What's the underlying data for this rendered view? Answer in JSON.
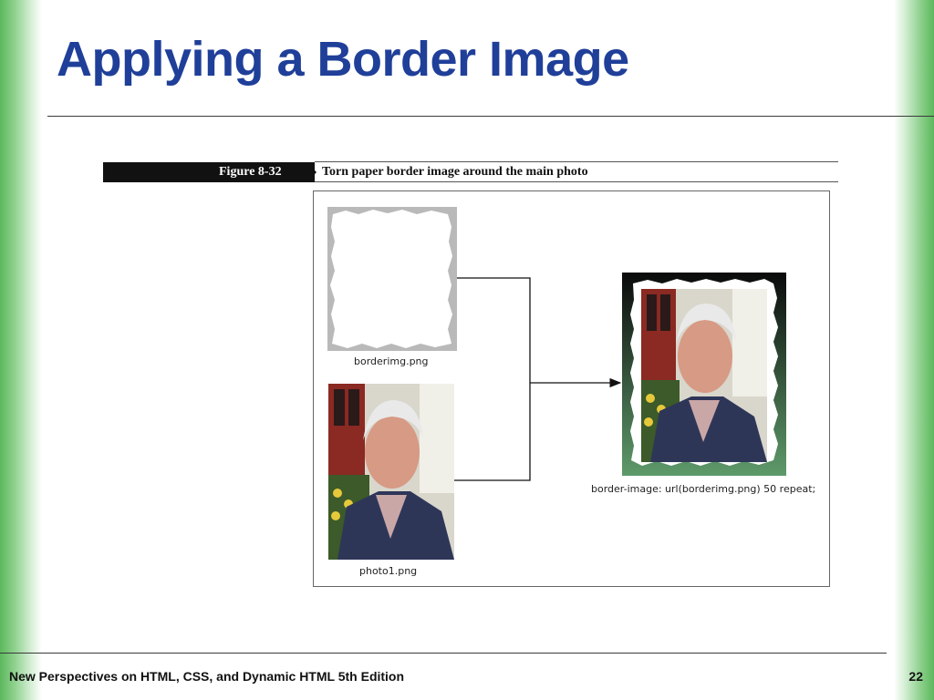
{
  "slide": {
    "title": "Applying a Border Image",
    "footer": "New Perspectives on HTML, CSS, and Dynamic HTML 5th Edition",
    "page_number": "22"
  },
  "figure": {
    "number": "Figure 8-32",
    "caption": "Torn paper border image around the main photo",
    "border_label": "borderimg.png",
    "photo_label": "photo1.png",
    "result_label": "border-image: url(borderimg.png) 50 repeat;"
  },
  "colors": {
    "title": "#1f3f99",
    "side_green": "#5cb85c"
  }
}
